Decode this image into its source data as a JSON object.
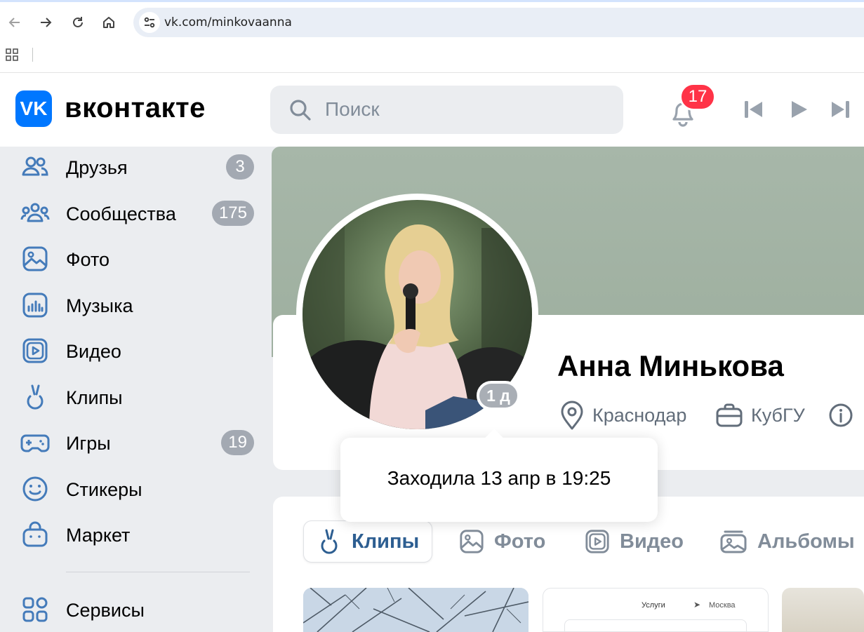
{
  "browser": {
    "url": "vk.com/minkovaanna",
    "back_icon": "arrow-left-icon",
    "forward_icon": "arrow-right-icon",
    "reload_icon": "reload-icon",
    "home_icon": "home-icon"
  },
  "header": {
    "logo_letters": "VK",
    "brand_name": "вконтакте",
    "search_placeholder": "Поиск",
    "notifications_count": "17",
    "brand_color": "#0077ff",
    "badge_color": "#ff3347"
  },
  "sidebar": {
    "items": [
      {
        "label": "Друзья",
        "count": "3",
        "icon": "friends-icon"
      },
      {
        "label": "Сообщества",
        "count": "175",
        "icon": "communities-icon"
      },
      {
        "label": "Фото",
        "count": "",
        "icon": "photo-icon"
      },
      {
        "label": "Музыка",
        "count": "",
        "icon": "music-icon"
      },
      {
        "label": "Видео",
        "count": "",
        "icon": "video-icon"
      },
      {
        "label": "Клипы",
        "count": "",
        "icon": "clips-icon"
      },
      {
        "label": "Игры",
        "count": "19",
        "icon": "games-icon"
      },
      {
        "label": "Стикеры",
        "count": "",
        "icon": "stickers-icon"
      },
      {
        "label": "Маркет",
        "count": "",
        "icon": "market-icon"
      },
      {
        "label": "Сервисы",
        "count": "",
        "icon": "services-icon"
      }
    ]
  },
  "profile": {
    "name": "Анна Минькова",
    "last_seen_badge": "1 д",
    "last_seen_tooltip": "Заходила 13 апр в 19:25",
    "city": "Краснодар",
    "university": "КубГУ"
  },
  "content_tabs": [
    {
      "label": "Клипы",
      "active": true
    },
    {
      "label": "Фото",
      "active": false
    },
    {
      "label": "Видео",
      "active": false
    },
    {
      "label": "Альбомы",
      "active": false
    }
  ],
  "thumbnail_texts": {
    "second_left": "Услуги",
    "second_right": "Москва"
  }
}
